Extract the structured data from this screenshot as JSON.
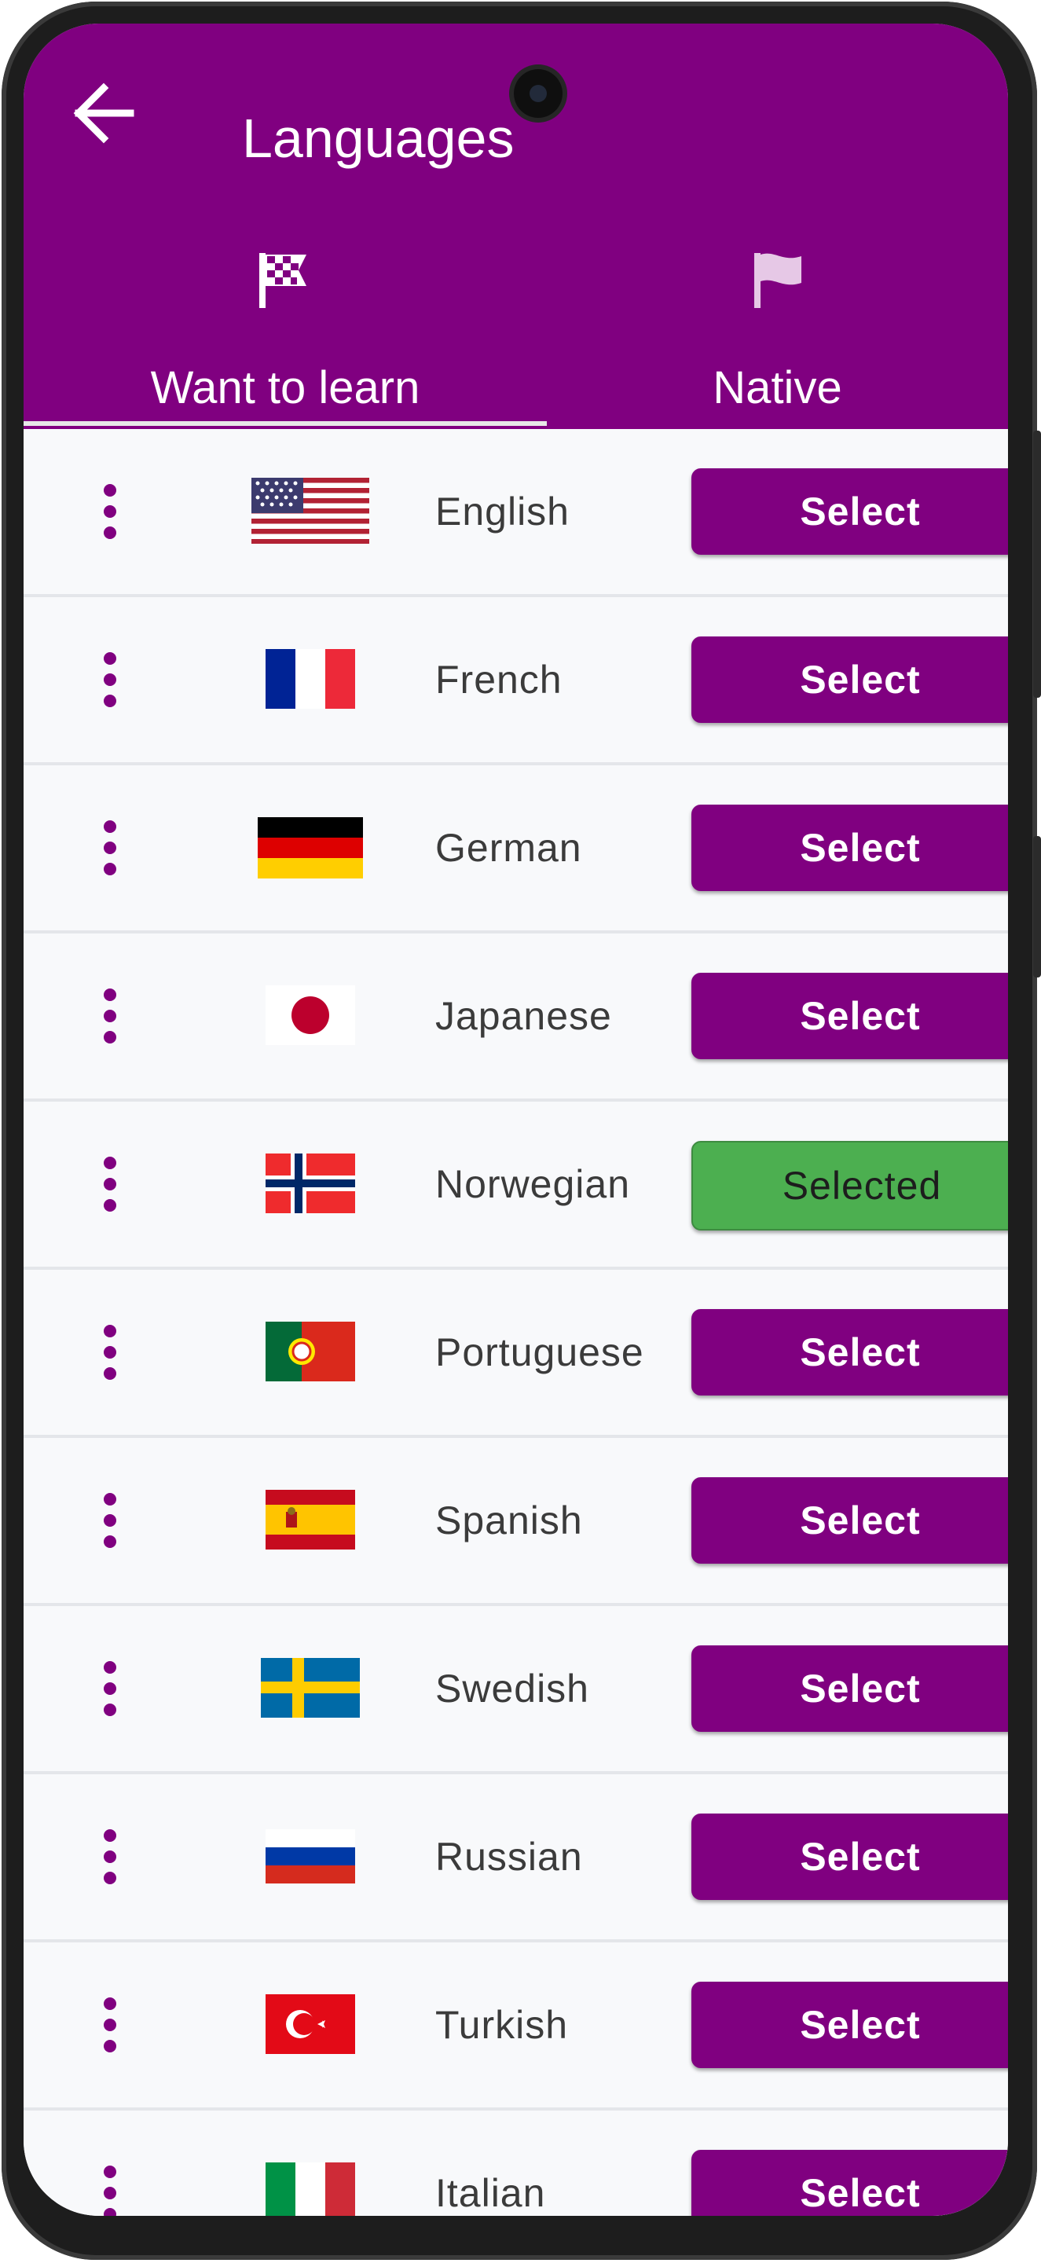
{
  "header": {
    "title": "Languages"
  },
  "tabs": [
    {
      "label": "Want to learn",
      "icon": "checkered-flag-icon",
      "active": true
    },
    {
      "label": "Native",
      "icon": "flag-icon",
      "active": false
    }
  ],
  "languages": [
    {
      "name": "English",
      "flag": "us-flag-icon",
      "button": "Select"
    },
    {
      "name": "French",
      "flag": "france-flag-icon",
      "button": "Select"
    },
    {
      "name": "German",
      "flag": "germany-flag-icon",
      "button": "Select"
    },
    {
      "name": "Japanese",
      "flag": "japan-flag-icon",
      "button": "Select"
    },
    {
      "name": "Norwegian",
      "flag": "norway-flag-icon",
      "button": "Selected"
    },
    {
      "name": "Portuguese",
      "flag": "portugal-flag-icon",
      "button": "Select"
    },
    {
      "name": "Spanish",
      "flag": "spain-flag-icon",
      "button": "Select"
    },
    {
      "name": "Swedish",
      "flag": "sweden-flag-icon",
      "button": "Select"
    },
    {
      "name": "Russian",
      "flag": "russia-flag-icon",
      "button": "Select"
    },
    {
      "name": "Turkish",
      "flag": "turkey-flag-icon",
      "button": "Select"
    },
    {
      "name": "Italian",
      "flag": "italy-flag-icon",
      "button": "Select"
    }
  ],
  "colors": {
    "primary": "#800080",
    "selected": "#4caf50",
    "background": "#f8f9fb",
    "text": "#3b3b3b"
  }
}
